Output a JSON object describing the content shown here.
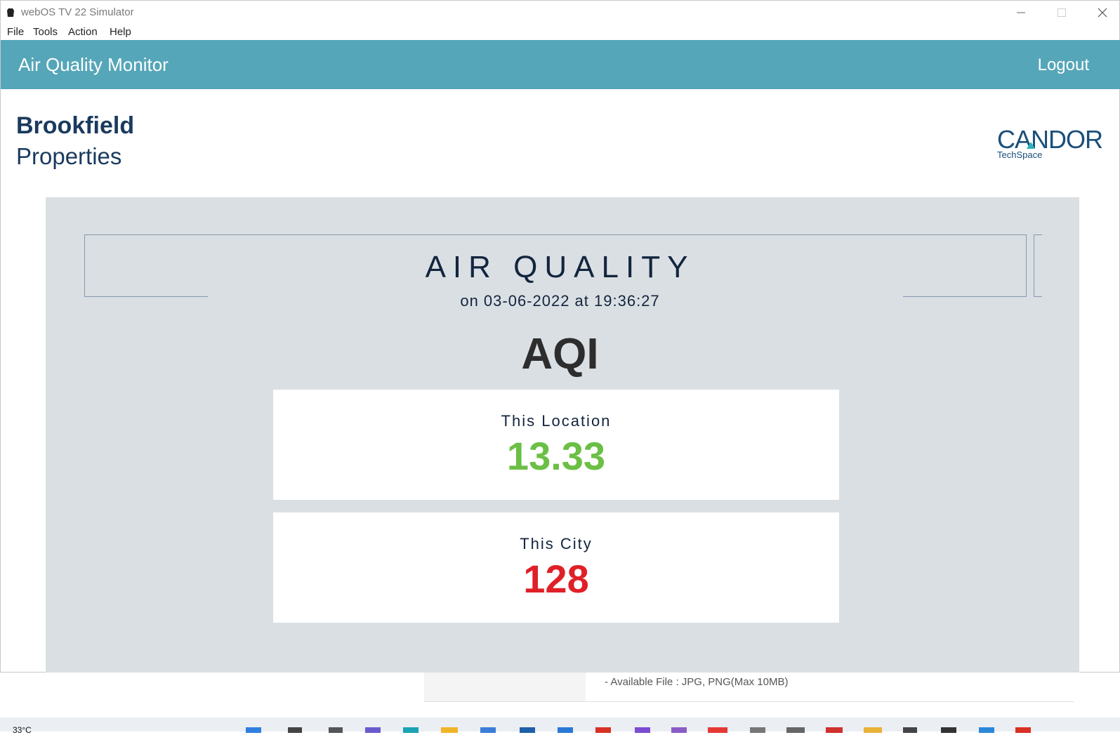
{
  "window": {
    "title": "webOS TV 22 Simulator",
    "menu": [
      "File",
      "Tools",
      "Action",
      "Help"
    ]
  },
  "app": {
    "title": "Air Quality Monitor",
    "logout_label": "Logout",
    "accent_color": "#55a6b8"
  },
  "logos": {
    "left_line1": "Brookfield",
    "left_line2": "Properties",
    "right_name": "CANDOR",
    "right_sub": "TechSpace"
  },
  "air_quality": {
    "heading": "AIR QUALITY",
    "timestamp": "on 03-06-2022 at 19:36:27",
    "index_label": "AQI",
    "location": {
      "label": "This Location",
      "value": "13.33",
      "color": "#6bbf45"
    },
    "city": {
      "label": "This City",
      "value": "128",
      "color": "#e02027"
    }
  },
  "background_page": {
    "note": "- Available File : JPG, PNG(Max 10MB)"
  },
  "taskbar": {
    "temperature": "33°C"
  }
}
